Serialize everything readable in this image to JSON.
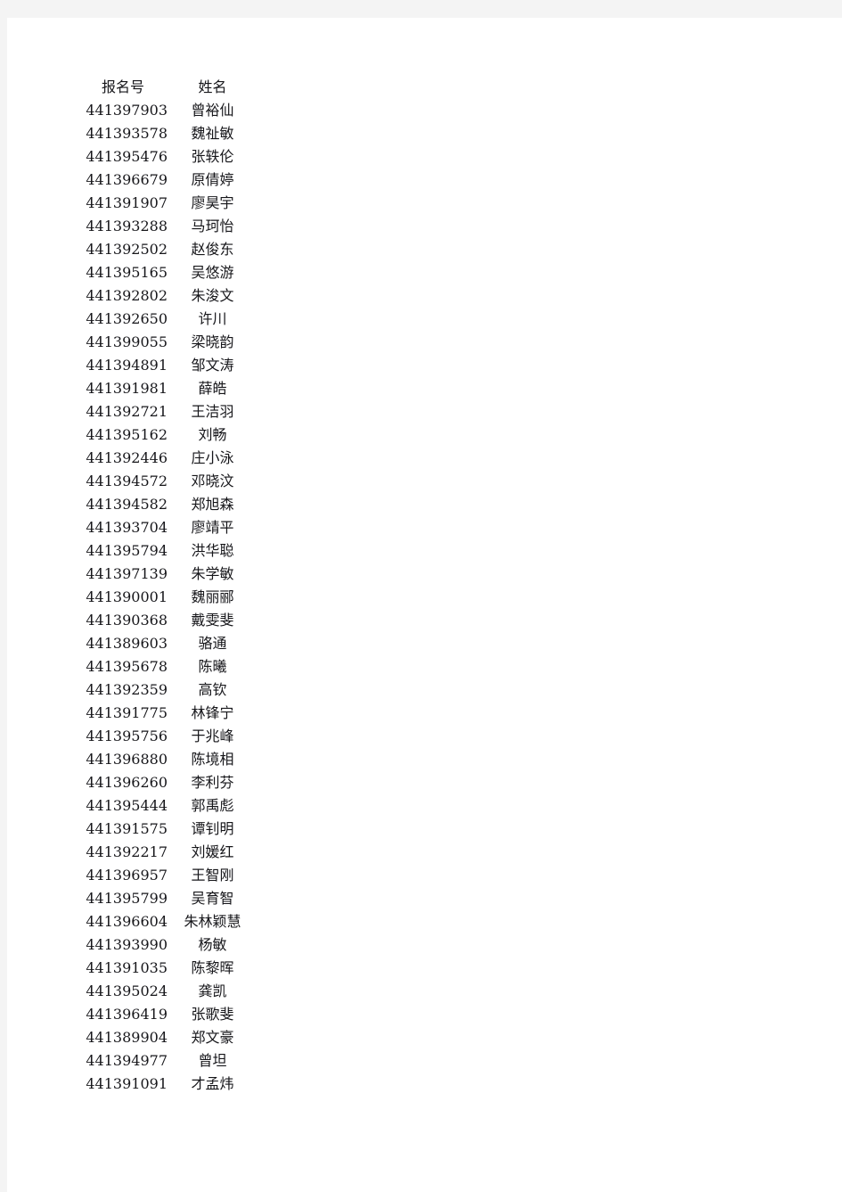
{
  "document": {
    "page_background": "#f4f4f4",
    "sheet_background": "#ffffff",
    "text_color": "#16161a"
  },
  "table": {
    "headers": {
      "id": "报名号",
      "name": "姓名"
    },
    "rows": [
      {
        "id": "441397903",
        "name": "曾裕仙"
      },
      {
        "id": "441393578",
        "name": "魏祉敏"
      },
      {
        "id": "441395476",
        "name": "张轶伦"
      },
      {
        "id": "441396679",
        "name": "原倩婷"
      },
      {
        "id": "441391907",
        "name": "廖昊宇"
      },
      {
        "id": "441393288",
        "name": "马珂怡"
      },
      {
        "id": "441392502",
        "name": "赵俊东"
      },
      {
        "id": "441395165",
        "name": "吴悠游"
      },
      {
        "id": "441392802",
        "name": "朱浚文"
      },
      {
        "id": "441392650",
        "name": "许川"
      },
      {
        "id": "441399055",
        "name": "梁晓韵"
      },
      {
        "id": "441394891",
        "name": "邹文涛"
      },
      {
        "id": "441391981",
        "name": "薛皓"
      },
      {
        "id": "441392721",
        "name": "王洁羽"
      },
      {
        "id": "441395162",
        "name": "刘畅"
      },
      {
        "id": "441392446",
        "name": "庄小泳"
      },
      {
        "id": "441394572",
        "name": "邓晓汶"
      },
      {
        "id": "441394582",
        "name": "郑旭森"
      },
      {
        "id": "441393704",
        "name": "廖靖平"
      },
      {
        "id": "441395794",
        "name": "洪华聪"
      },
      {
        "id": "441397139",
        "name": "朱学敏"
      },
      {
        "id": "441390001",
        "name": "魏丽郦"
      },
      {
        "id": "441390368",
        "name": "戴雯斐"
      },
      {
        "id": "441389603",
        "name": "骆通"
      },
      {
        "id": "441395678",
        "name": "陈曦"
      },
      {
        "id": "441392359",
        "name": "高钦"
      },
      {
        "id": "441391775",
        "name": "林锋宁"
      },
      {
        "id": "441395756",
        "name": "于兆峰"
      },
      {
        "id": "441396880",
        "name": "陈境相"
      },
      {
        "id": "441396260",
        "name": "李利芬"
      },
      {
        "id": "441395444",
        "name": "郭禹彪"
      },
      {
        "id": "441391575",
        "name": "谭钊明"
      },
      {
        "id": "441392217",
        "name": "刘媛红"
      },
      {
        "id": "441396957",
        "name": "王智刚"
      },
      {
        "id": "441395799",
        "name": "吴育智"
      },
      {
        "id": "441396604",
        "name": "朱林颖慧"
      },
      {
        "id": "441393990",
        "name": "杨敏"
      },
      {
        "id": "441391035",
        "name": "陈黎晖"
      },
      {
        "id": "441395024",
        "name": "龚凯"
      },
      {
        "id": "441396419",
        "name": "张歌斐"
      },
      {
        "id": "441389904",
        "name": "郑文豪"
      },
      {
        "id": "441394977",
        "name": "曾坦"
      },
      {
        "id": "441391091",
        "name": "才孟炜"
      }
    ]
  }
}
